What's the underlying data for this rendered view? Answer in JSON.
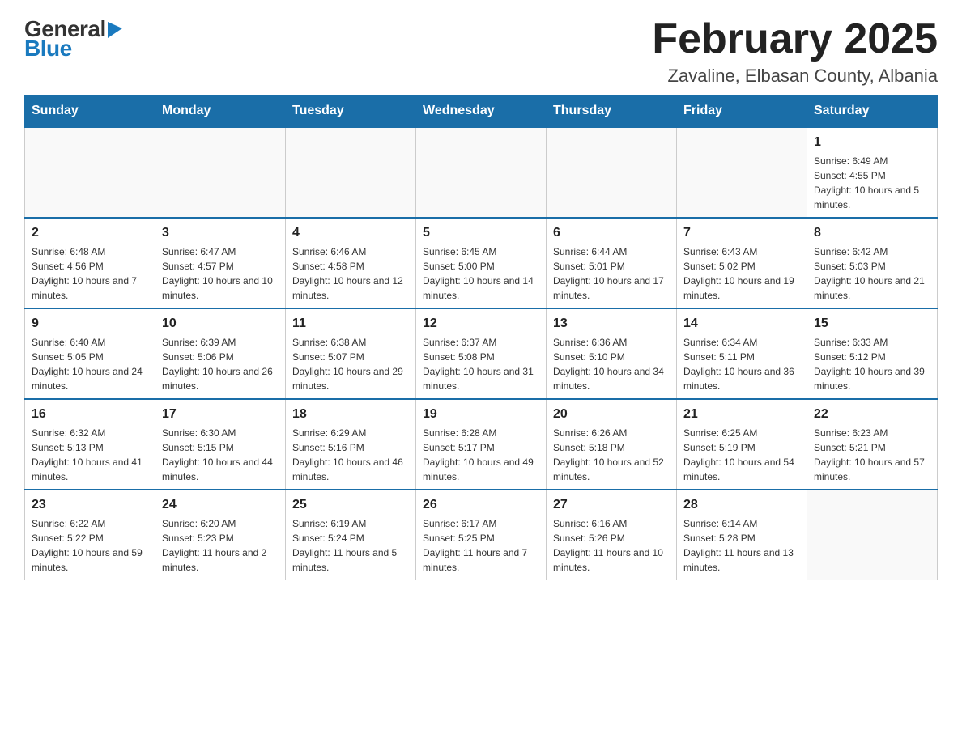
{
  "header": {
    "logo_general": "General",
    "logo_blue": "Blue",
    "month_title": "February 2025",
    "location": "Zavaline, Elbasan County, Albania"
  },
  "days_of_week": [
    "Sunday",
    "Monday",
    "Tuesday",
    "Wednesday",
    "Thursday",
    "Friday",
    "Saturday"
  ],
  "weeks": [
    [
      {
        "day": "",
        "info": ""
      },
      {
        "day": "",
        "info": ""
      },
      {
        "day": "",
        "info": ""
      },
      {
        "day": "",
        "info": ""
      },
      {
        "day": "",
        "info": ""
      },
      {
        "day": "",
        "info": ""
      },
      {
        "day": "1",
        "info": "Sunrise: 6:49 AM\nSunset: 4:55 PM\nDaylight: 10 hours and 5 minutes."
      }
    ],
    [
      {
        "day": "2",
        "info": "Sunrise: 6:48 AM\nSunset: 4:56 PM\nDaylight: 10 hours and 7 minutes."
      },
      {
        "day": "3",
        "info": "Sunrise: 6:47 AM\nSunset: 4:57 PM\nDaylight: 10 hours and 10 minutes."
      },
      {
        "day": "4",
        "info": "Sunrise: 6:46 AM\nSunset: 4:58 PM\nDaylight: 10 hours and 12 minutes."
      },
      {
        "day": "5",
        "info": "Sunrise: 6:45 AM\nSunset: 5:00 PM\nDaylight: 10 hours and 14 minutes."
      },
      {
        "day": "6",
        "info": "Sunrise: 6:44 AM\nSunset: 5:01 PM\nDaylight: 10 hours and 17 minutes."
      },
      {
        "day": "7",
        "info": "Sunrise: 6:43 AM\nSunset: 5:02 PM\nDaylight: 10 hours and 19 minutes."
      },
      {
        "day": "8",
        "info": "Sunrise: 6:42 AM\nSunset: 5:03 PM\nDaylight: 10 hours and 21 minutes."
      }
    ],
    [
      {
        "day": "9",
        "info": "Sunrise: 6:40 AM\nSunset: 5:05 PM\nDaylight: 10 hours and 24 minutes."
      },
      {
        "day": "10",
        "info": "Sunrise: 6:39 AM\nSunset: 5:06 PM\nDaylight: 10 hours and 26 minutes."
      },
      {
        "day": "11",
        "info": "Sunrise: 6:38 AM\nSunset: 5:07 PM\nDaylight: 10 hours and 29 minutes."
      },
      {
        "day": "12",
        "info": "Sunrise: 6:37 AM\nSunset: 5:08 PM\nDaylight: 10 hours and 31 minutes."
      },
      {
        "day": "13",
        "info": "Sunrise: 6:36 AM\nSunset: 5:10 PM\nDaylight: 10 hours and 34 minutes."
      },
      {
        "day": "14",
        "info": "Sunrise: 6:34 AM\nSunset: 5:11 PM\nDaylight: 10 hours and 36 minutes."
      },
      {
        "day": "15",
        "info": "Sunrise: 6:33 AM\nSunset: 5:12 PM\nDaylight: 10 hours and 39 minutes."
      }
    ],
    [
      {
        "day": "16",
        "info": "Sunrise: 6:32 AM\nSunset: 5:13 PM\nDaylight: 10 hours and 41 minutes."
      },
      {
        "day": "17",
        "info": "Sunrise: 6:30 AM\nSunset: 5:15 PM\nDaylight: 10 hours and 44 minutes."
      },
      {
        "day": "18",
        "info": "Sunrise: 6:29 AM\nSunset: 5:16 PM\nDaylight: 10 hours and 46 minutes."
      },
      {
        "day": "19",
        "info": "Sunrise: 6:28 AM\nSunset: 5:17 PM\nDaylight: 10 hours and 49 minutes."
      },
      {
        "day": "20",
        "info": "Sunrise: 6:26 AM\nSunset: 5:18 PM\nDaylight: 10 hours and 52 minutes."
      },
      {
        "day": "21",
        "info": "Sunrise: 6:25 AM\nSunset: 5:19 PM\nDaylight: 10 hours and 54 minutes."
      },
      {
        "day": "22",
        "info": "Sunrise: 6:23 AM\nSunset: 5:21 PM\nDaylight: 10 hours and 57 minutes."
      }
    ],
    [
      {
        "day": "23",
        "info": "Sunrise: 6:22 AM\nSunset: 5:22 PM\nDaylight: 10 hours and 59 minutes."
      },
      {
        "day": "24",
        "info": "Sunrise: 6:20 AM\nSunset: 5:23 PM\nDaylight: 11 hours and 2 minutes."
      },
      {
        "day": "25",
        "info": "Sunrise: 6:19 AM\nSunset: 5:24 PM\nDaylight: 11 hours and 5 minutes."
      },
      {
        "day": "26",
        "info": "Sunrise: 6:17 AM\nSunset: 5:25 PM\nDaylight: 11 hours and 7 minutes."
      },
      {
        "day": "27",
        "info": "Sunrise: 6:16 AM\nSunset: 5:26 PM\nDaylight: 11 hours and 10 minutes."
      },
      {
        "day": "28",
        "info": "Sunrise: 6:14 AM\nSunset: 5:28 PM\nDaylight: 11 hours and 13 minutes."
      },
      {
        "day": "",
        "info": ""
      }
    ]
  ]
}
